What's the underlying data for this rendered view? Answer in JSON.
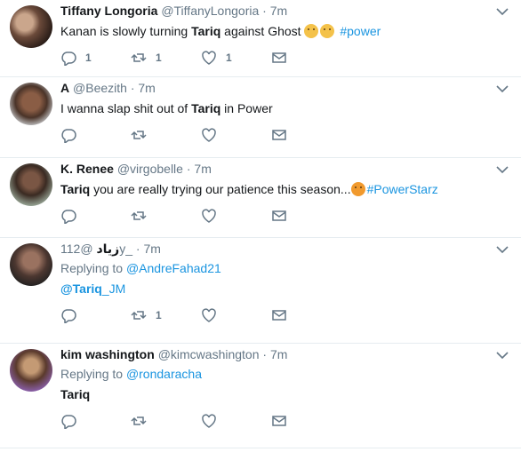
{
  "colors": {
    "text": "#14171a",
    "muted": "#657786",
    "link": "#1b95e0",
    "border": "#e6ecf0"
  },
  "icons": {
    "reply": "reply-icon",
    "retweet": "retweet-icon",
    "like": "heart-icon",
    "dm": "envelope-icon",
    "more": "chevron-down-icon"
  },
  "tweets": [
    {
      "name": "Tiffany Longoria",
      "handle": "@TiffanyLongoria",
      "time": "7m",
      "text_pre": "Kanan is slowly turning ",
      "text_bold": "Tariq",
      "text_post": " against Ghost ",
      "hashtag": "#power",
      "reply_count": "1",
      "retweet_count": "1",
      "like_count": "1"
    },
    {
      "name": "A",
      "handle": "@Beezith",
      "time": "7m",
      "text_pre": "I wanna slap shit out of ",
      "text_bold": "Tariq",
      "text_post": " in Power"
    },
    {
      "name": "K. Renee",
      "handle": "@virgobelle",
      "time": "7m",
      "text_bold": "Tariq",
      "text_post": " you are really trying our patience this season...",
      "hashtag": "#PowerStarz"
    },
    {
      "name": "زياد",
      "handle": "@112y_",
      "time": "7m",
      "replying_label": "Replying to",
      "replying_to": "@AndreFahad21",
      "mention_bold": "@Tariq",
      "mention_rest": "_JM",
      "retweet_count": "1"
    },
    {
      "name": "kim washington",
      "handle": "@kimcwashington",
      "time": "7m",
      "replying_label": "Replying to",
      "replying_to": "@rondaracha",
      "text_bold": "Tariq"
    }
  ]
}
